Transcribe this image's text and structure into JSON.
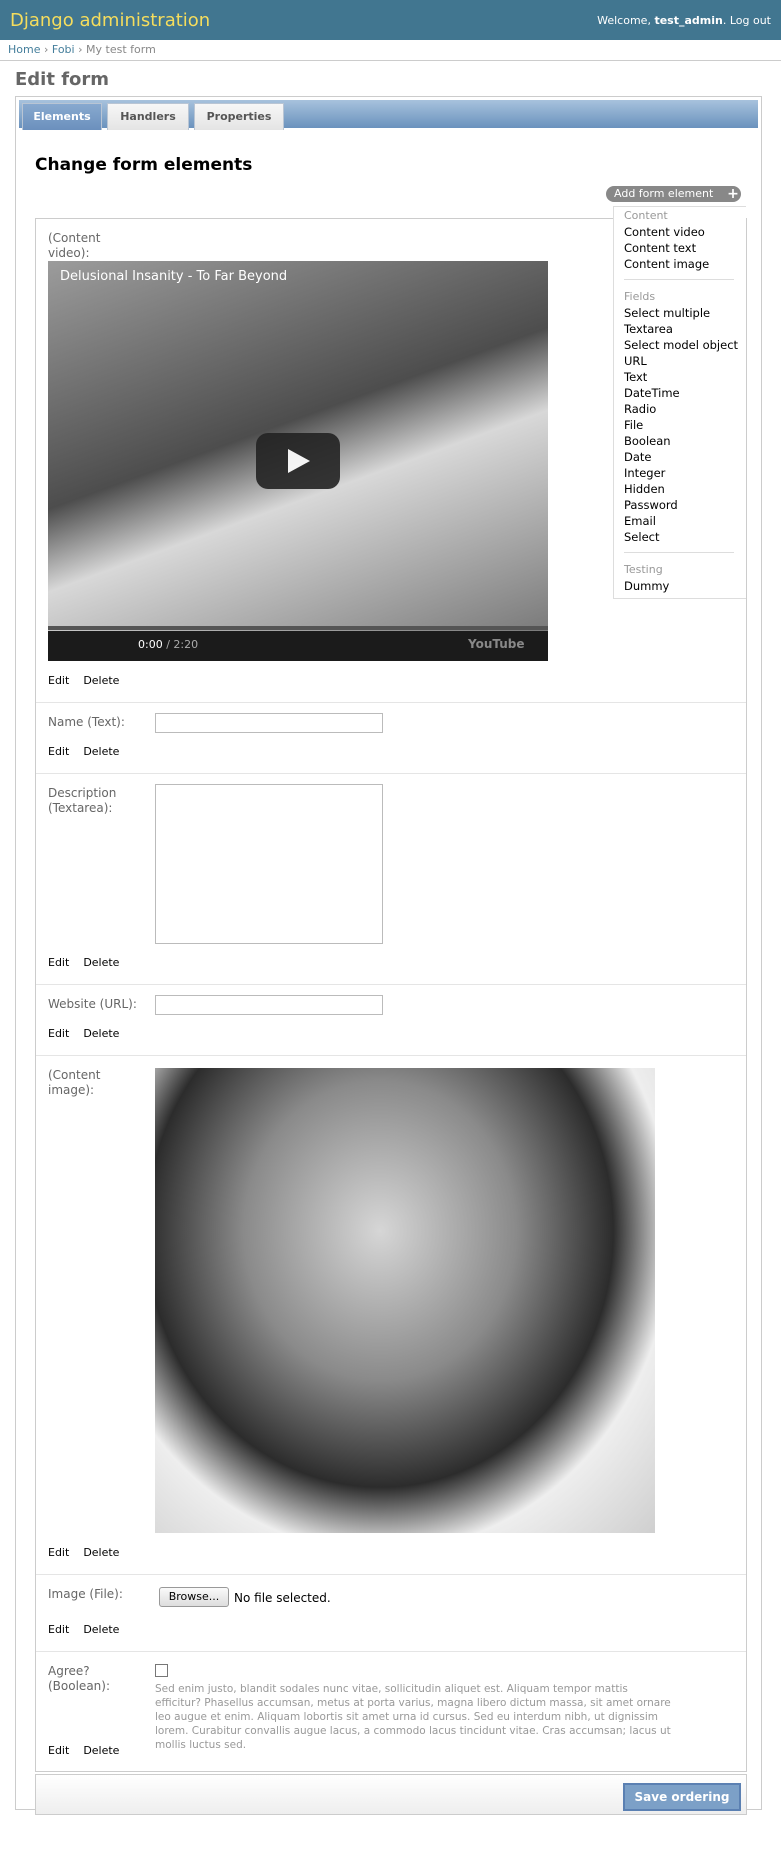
{
  "header": {
    "brand": "Django administration",
    "welcome": "Welcome, ",
    "username": "test_admin",
    "logout": "Log out"
  },
  "breadcrumbs": {
    "home": "Home",
    "fobi": "Fobi",
    "current": "My test form",
    "sep": "›"
  },
  "page_title": "Edit form",
  "tabs": [
    "Elements",
    "Handlers",
    "Properties"
  ],
  "section_title": "Change form elements",
  "add_button": {
    "label": "Add form element",
    "plus": "+"
  },
  "dropdown": {
    "groups": [
      {
        "title": "Content",
        "items": [
          "Content video",
          "Content text",
          "Content image"
        ]
      },
      {
        "title": "Fields",
        "items": [
          "Select multiple",
          "Textarea",
          "Select model object",
          "URL",
          "Text",
          "DateTime",
          "Radio",
          "File",
          "Boolean",
          "Date",
          "Integer",
          "Hidden",
          "Password",
          "Email",
          "Select"
        ]
      },
      {
        "title": "Testing",
        "items": [
          "Dummy"
        ]
      }
    ]
  },
  "actions": {
    "edit": "Edit",
    "delete": "Delete"
  },
  "elements": {
    "video": {
      "label": "(Content video):",
      "title": "Delusional Insanity - To Far Beyond",
      "time": "0:00",
      "duration": " / 2:20",
      "yt": "YouTube",
      "progress": 0.0
    },
    "name": {
      "label": "Name (Text):"
    },
    "description": {
      "label": "Description (Textarea):"
    },
    "website": {
      "label": "Website (URL):"
    },
    "image": {
      "label": "(Content image):"
    },
    "file": {
      "label": "Image (File):",
      "browse": "Browse...",
      "status": "No file selected."
    },
    "agree": {
      "label": "Agree? (Boolean):",
      "help": "Sed enim justo, blandit sodales nunc vitae, sollicitudin aliquet est. Aliquam tempor mattis efficitur? Phasellus accumsan, metus at porta varius, magna libero dictum massa, sit amet ornare leo augue et enim. Aliquam lobortis sit amet urna id cursus. Sed eu interdum nibh, ut dignissim lorem. Curabitur convallis augue lacus, a commodo lacus tincidunt vitae. Cras accumsan; lacus ut mollis luctus sed."
    }
  },
  "save_button": "Save ordering"
}
